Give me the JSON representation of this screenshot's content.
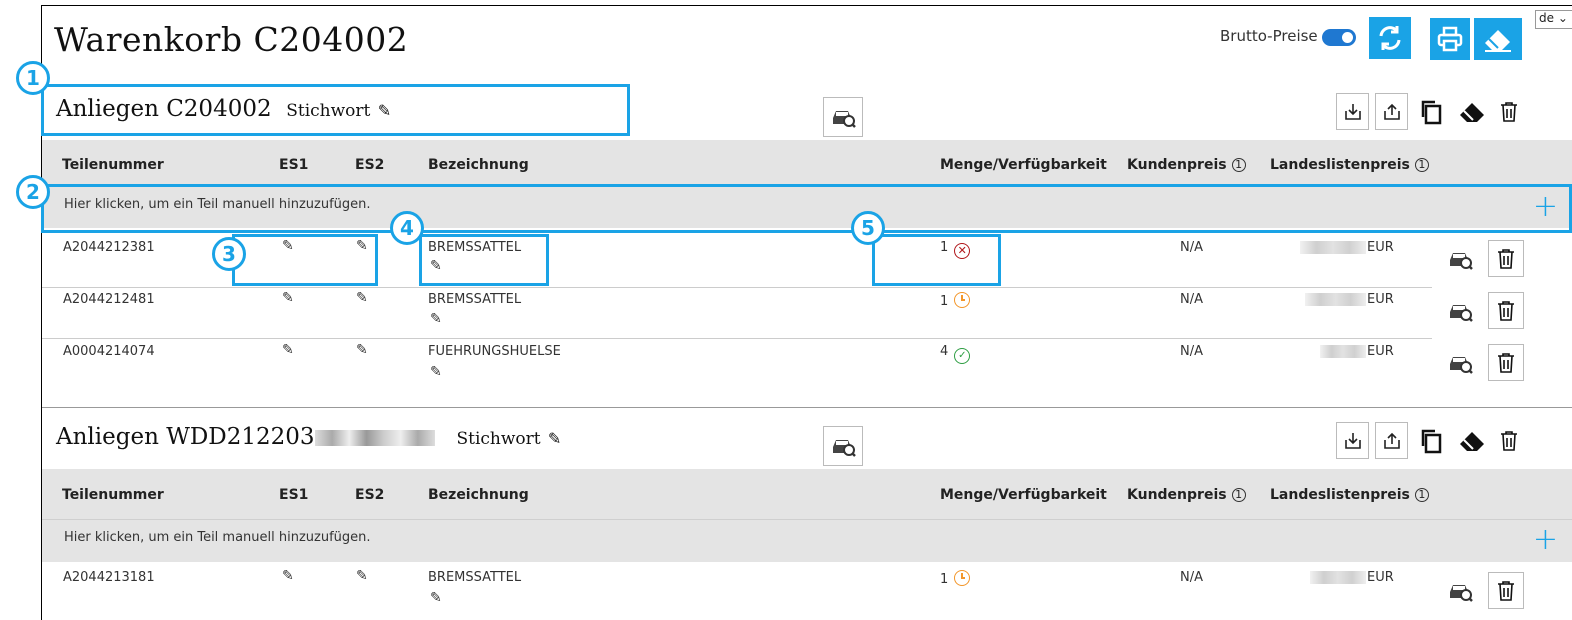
{
  "header": {
    "title": "Warenkorb C204002",
    "brutto_label": "Brutto-Preise",
    "brutto_enabled": true,
    "language": "de"
  },
  "columns": {
    "teilenummer": "Teilenummer",
    "es1": "ES1",
    "es2": "ES2",
    "bezeichnung": "Bezeichnung",
    "menge": "Menge/Verfügbarkeit",
    "kundenpreis": "Kundenpreis",
    "landespreis": "Landeslistenpreis",
    "info_symbol": "1"
  },
  "add_row_text": "Hier klicken, um ein Teil manuell hinzuzufügen.",
  "groups": [
    {
      "title": "Anliegen C204002",
      "keyword_label": "Stichwort",
      "rows": [
        {
          "part": "A2044212381",
          "desc": "BREMSSATTEL",
          "qty": "1",
          "status": "unavailable",
          "customer_price": "N/A",
          "currency": "EUR"
        },
        {
          "part": "A2044212481",
          "desc": "BREMSSATTEL",
          "qty": "1",
          "status": "pending",
          "customer_price": "N/A",
          "currency": "EUR"
        },
        {
          "part": "A0004214074",
          "desc": "FUEHRUNGSHUELSE",
          "qty": "4",
          "status": "available",
          "customer_price": "N/A",
          "currency": "EUR"
        }
      ]
    },
    {
      "title": "Anliegen WDD212203",
      "keyword_label": "Stichwort",
      "rows": [
        {
          "part": "A2044213181",
          "desc": "BREMSSATTEL",
          "qty": "1",
          "status": "pending",
          "customer_price": "N/A",
          "currency": "EUR"
        }
      ]
    }
  ],
  "callouts": [
    "1",
    "2",
    "3",
    "4",
    "5"
  ],
  "colors": {
    "accent": "#1aa3e6",
    "unavailable": "#b0161a",
    "pending": "#f3962a",
    "available": "#2f9e44"
  }
}
